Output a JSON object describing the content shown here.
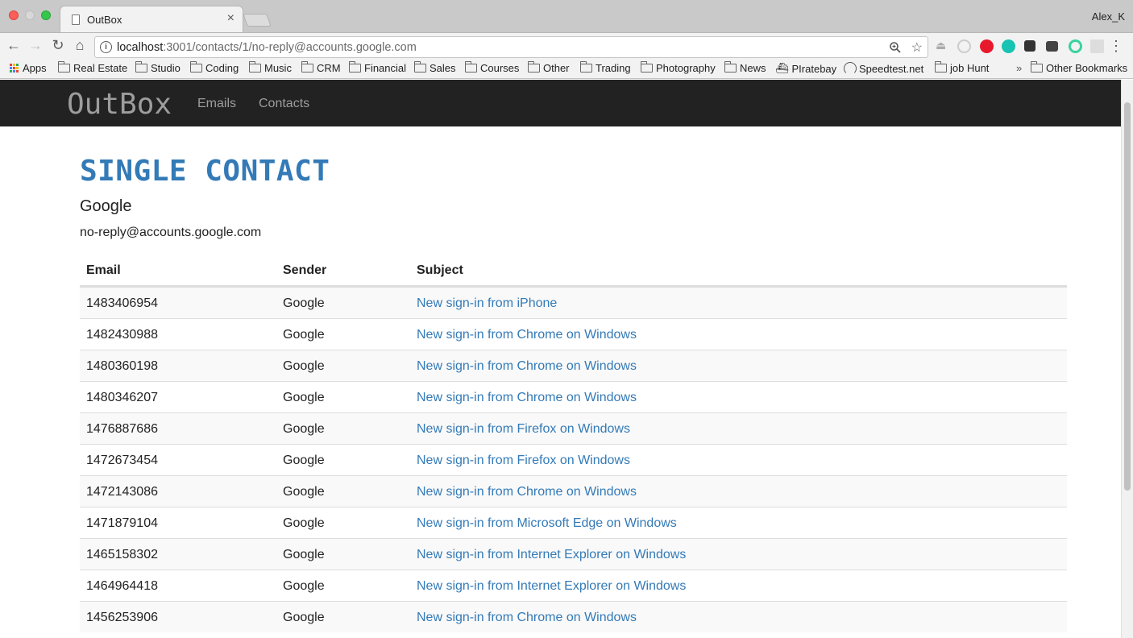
{
  "browser": {
    "tab_title": "OutBox",
    "tab_close": "×",
    "user": "Alex_K",
    "url_host": "localhost",
    "url_rest": ":3001/contacts/1/no-reply@accounts.google.com",
    "bookmarks": [
      {
        "label": "Apps",
        "icon": "apps-grid-icon"
      },
      {
        "label": "Real Estate",
        "icon": "folder-icon"
      },
      {
        "label": "Studio",
        "icon": "folder-icon"
      },
      {
        "label": "Coding",
        "icon": "folder-icon"
      },
      {
        "label": "Music",
        "icon": "folder-icon"
      },
      {
        "label": "CRM",
        "icon": "folder-icon"
      },
      {
        "label": "Financial",
        "icon": "folder-icon"
      },
      {
        "label": "Sales",
        "icon": "folder-icon"
      },
      {
        "label": "Courses",
        "icon": "folder-icon"
      },
      {
        "label": "Other",
        "icon": "folder-icon"
      },
      {
        "label": "Trading",
        "icon": "folder-icon"
      },
      {
        "label": "Photography",
        "icon": "folder-icon"
      },
      {
        "label": "News",
        "icon": "folder-icon"
      },
      {
        "label": "PIratebay",
        "icon": "pirate-ship-icon"
      },
      {
        "label": "Speedtest.net",
        "icon": "speedometer-icon"
      },
      {
        "label": "job Hunt",
        "icon": "folder-icon"
      },
      {
        "label": "Other Bookmarks",
        "icon": "folder-icon"
      }
    ],
    "overflow_chevron": "»"
  },
  "navbar": {
    "brand": "OutBox",
    "links": [
      "Emails",
      "Contacts"
    ]
  },
  "page": {
    "title": "SINGLE CONTACT",
    "contact_name": "Google",
    "contact_email": "no-reply@accounts.google.com"
  },
  "table": {
    "headers": [
      "Email",
      "Sender",
      "Subject"
    ],
    "rows": [
      {
        "email": "1483406954",
        "sender": "Google",
        "subject": "New sign-in from iPhone"
      },
      {
        "email": "1482430988",
        "sender": "Google",
        "subject": "New sign-in from Chrome on Windows"
      },
      {
        "email": "1480360198",
        "sender": "Google",
        "subject": "New sign-in from Chrome on Windows"
      },
      {
        "email": "1480346207",
        "sender": "Google",
        "subject": "New sign-in from Chrome on Windows"
      },
      {
        "email": "1476887686",
        "sender": "Google",
        "subject": "New sign-in from Firefox on Windows"
      },
      {
        "email": "1472673454",
        "sender": "Google",
        "subject": "New sign-in from Firefox on Windows"
      },
      {
        "email": "1472143086",
        "sender": "Google",
        "subject": "New sign-in from Chrome on Windows"
      },
      {
        "email": "1471879104",
        "sender": "Google",
        "subject": "New sign-in from Microsoft Edge on Windows"
      },
      {
        "email": "1465158302",
        "sender": "Google",
        "subject": "New sign-in from Internet Explorer on Windows"
      },
      {
        "email": "1464964418",
        "sender": "Google",
        "subject": "New sign-in from Internet Explorer on Windows"
      },
      {
        "email": "1456253906",
        "sender": "Google",
        "subject": "New sign-in from Chrome on Windows"
      }
    ]
  },
  "colors": {
    "navbar_bg": "#222222",
    "link": "#337ab7",
    "stripe": "#f9f9f9"
  }
}
